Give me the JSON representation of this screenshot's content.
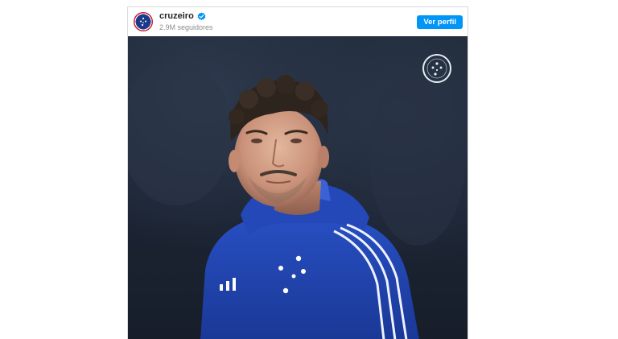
{
  "profile": {
    "username": "cruzeiro",
    "followers": "2.9M seguidores",
    "view_profile_label": "Ver perfil",
    "verified": true
  },
  "icons": {
    "avatar": "cruzeiro-crest-icon",
    "verified": "verified-badge-icon",
    "watermark": "cruzeiro-crest-watermark"
  },
  "colors": {
    "button": "#0095f6",
    "verified": "#0095f6",
    "jacket": "#1e40b0",
    "background": "#1c2434"
  }
}
